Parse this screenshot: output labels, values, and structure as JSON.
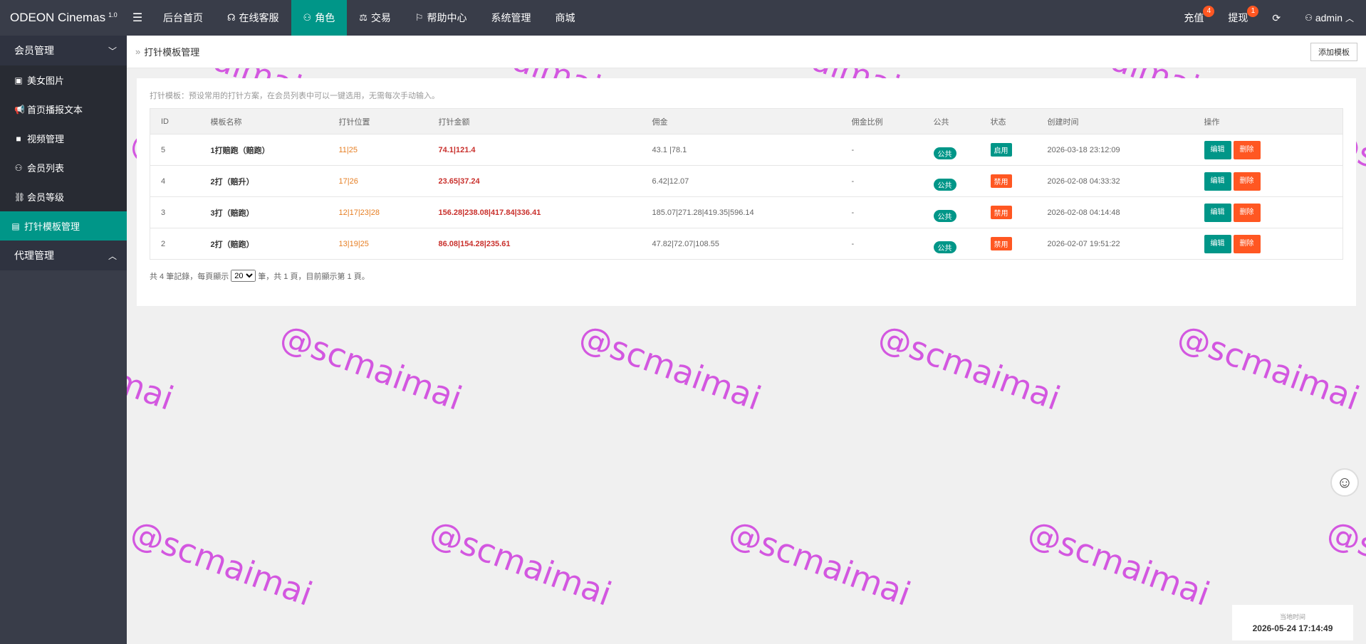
{
  "app": {
    "logo": "ODEON Cinemas",
    "version": "1.0"
  },
  "topnav": [
    {
      "label": "后台首页",
      "icon": ""
    },
    {
      "label": "在线客服",
      "icon": "headset-icon"
    },
    {
      "label": "角色",
      "icon": "user-icon",
      "active": true
    },
    {
      "label": "交易",
      "icon": "balance-icon"
    },
    {
      "label": "帮助中心",
      "icon": "flag-icon"
    },
    {
      "label": "系统管理",
      "icon": ""
    },
    {
      "label": "商城",
      "icon": ""
    }
  ],
  "topright": {
    "recharge": "充值",
    "recharge_badge": "4",
    "withdraw": "提现",
    "withdraw_badge": "1",
    "user": "admin"
  },
  "sidebar": {
    "group1": "会员管理",
    "items": [
      {
        "label": "美女图片",
        "icon": "image-icon"
      },
      {
        "label": "首页播报文本",
        "icon": "megaphone-icon"
      },
      {
        "label": "视频管理",
        "icon": "video-icon"
      },
      {
        "label": "会员列表",
        "icon": "user-icon"
      },
      {
        "label": "会员等级",
        "icon": "link-icon"
      },
      {
        "label": "打针模板管理",
        "icon": "template-icon",
        "active": true
      }
    ],
    "group2": "代理管理"
  },
  "page": {
    "breadcrumb": "打针模板管理",
    "add_button": "添加模板",
    "description": "打针模板：预设常用的打针方案，在会员列表中可以一键选用，无需每次手动输入。"
  },
  "table": {
    "headers": [
      "ID",
      "模板名称",
      "打针位置",
      "打针金额",
      "佣金",
      "佣金比例",
      "公共",
      "状态",
      "创建时间",
      "操作"
    ],
    "rows": [
      {
        "id": "5",
        "name": "1打赔跑（赔跑）",
        "pos": "11|25",
        "amount": "74.1|121.4",
        "commission": "43.1 |78.1",
        "ratio": "-",
        "public": "公共",
        "status": "启用",
        "created": "2026-03-18 23:12:09"
      },
      {
        "id": "4",
        "name": "2打（赔升）",
        "pos": "17|26",
        "amount": "23.65|37.24",
        "commission": "6.42|12.07",
        "ratio": "-",
        "public": "公共",
        "status": "禁用",
        "created": "2026-02-08 04:33:32"
      },
      {
        "id": "3",
        "name": "3打（赔跑）",
        "pos": "12|17|23|28",
        "amount": "156.28|238.08|417.84|336.41",
        "commission": "185.07|271.28|419.35|596.14",
        "ratio": "-",
        "public": "公共",
        "status": "禁用",
        "created": "2026-02-08 04:14:48"
      },
      {
        "id": "2",
        "name": "2打（赔跑）",
        "pos": "13|19|25",
        "amount": "86.08|154.28|235.61",
        "commission": "47.82|72.07|108.55",
        "ratio": "-",
        "public": "公共",
        "status": "禁用",
        "created": "2026-02-07 19:51:22"
      }
    ],
    "edit_label": "编辑",
    "delete_label": "删除"
  },
  "pager": {
    "prefix": "共 4 筆記錄，每頁顯示",
    "per_page": "20",
    "suffix": "筆，共 1 頁，目前顯示第 1 頁。"
  },
  "watermark": "@scmaimai",
  "clock": {
    "label": "当地时间",
    "value": "2026-05-24 17:14:49"
  }
}
